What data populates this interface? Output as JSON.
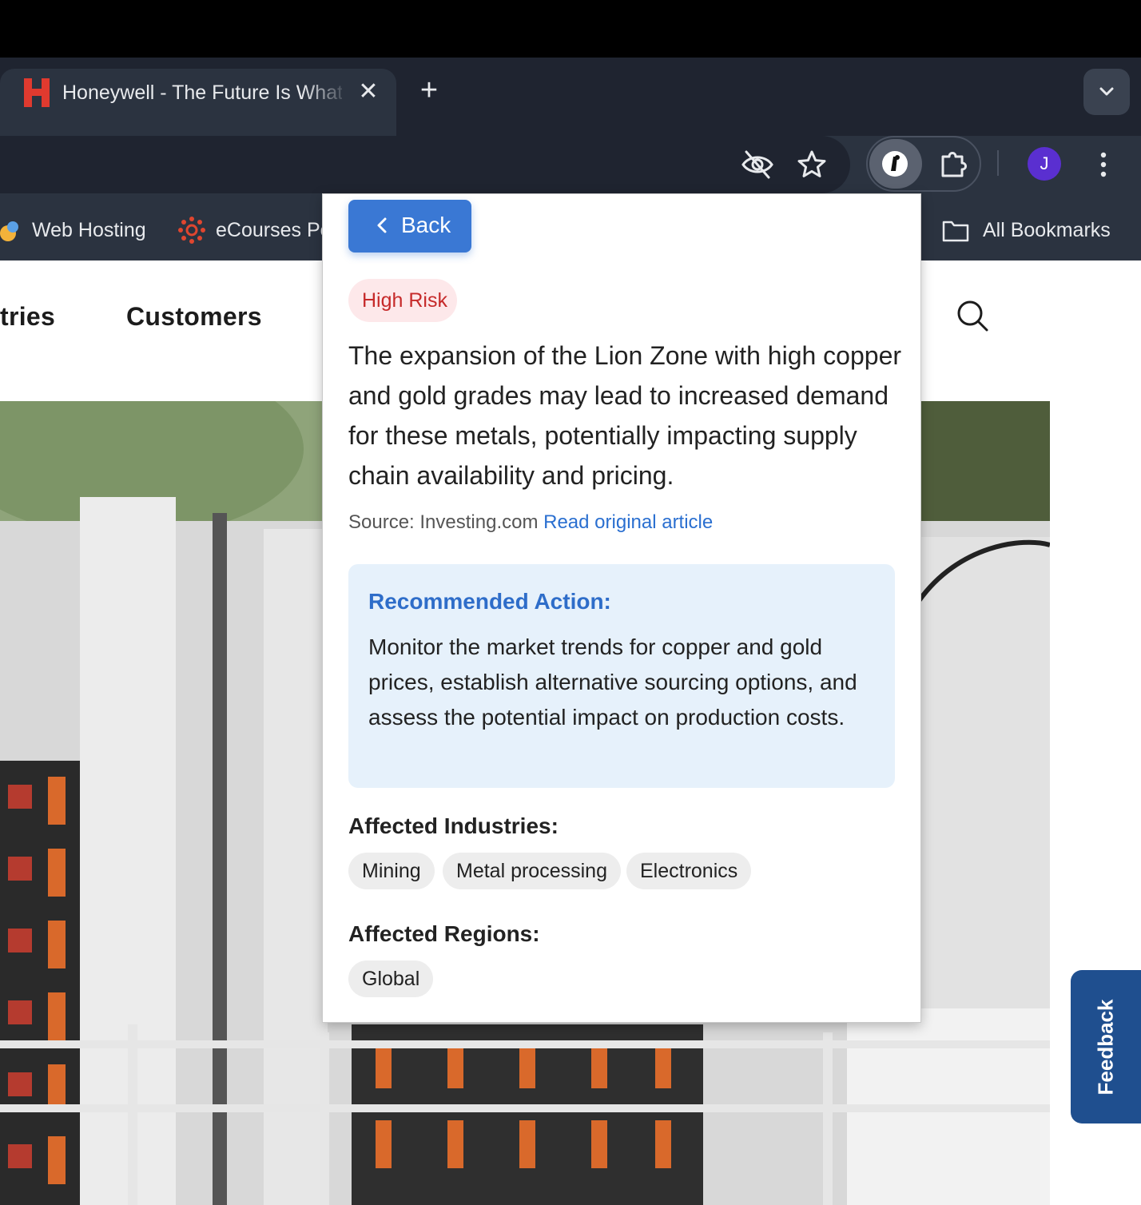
{
  "browser": {
    "tab": {
      "title": "Honeywell - The Future Is What We Make It",
      "close_glyph": "✕"
    },
    "new_tab_glyph": "+",
    "avatar_initial": "J",
    "bookmarks": [
      {
        "label": "Web Hosting"
      },
      {
        "label": "eCourses Portal"
      }
    ],
    "all_bookmarks_label": "All Bookmarks"
  },
  "page": {
    "nav": {
      "industries": "tries",
      "customers": "Customers"
    },
    "feedback_label": "Feedback"
  },
  "popup": {
    "back_label": "Back",
    "risk_label": "High Risk",
    "summary": "The expansion of the Lion Zone with high copper and gold grades may lead to increased demand for these metals, potentially impacting supply chain availability and pricing.",
    "source_prefix": "Source: Investing.com",
    "source_link": "Read original article",
    "recommended_action": {
      "title": "Recommended Action:",
      "text": "Monitor the market trends for copper and gold prices, establish alternative sourcing options, and assess the potential impact on production costs."
    },
    "affected_industries": {
      "title": "Affected Industries:",
      "items": [
        "Mining",
        "Metal processing",
        "Electronics"
      ]
    },
    "affected_regions": {
      "title": "Affected Regions:",
      "items": [
        "Global"
      ]
    }
  },
  "colors": {
    "accent": "#3a78d4",
    "risk_text": "#c62a2a",
    "risk_bg": "#fde8ea",
    "action_bg": "#e6f1fb",
    "brand_red": "#e03a2f"
  }
}
